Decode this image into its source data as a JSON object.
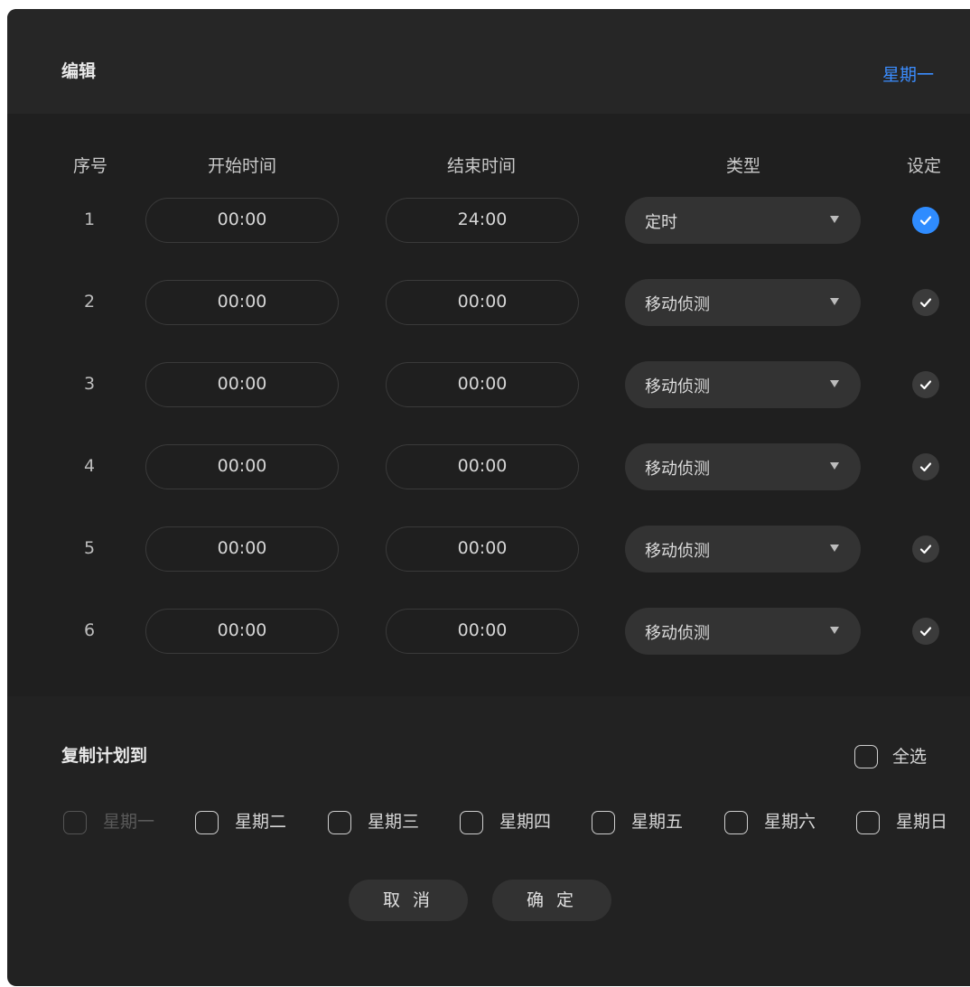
{
  "header": {
    "title": "编辑",
    "day": "星期一"
  },
  "columns": {
    "index": "序号",
    "start": "开始时间",
    "end": "结束时间",
    "type": "类型",
    "set": "设定"
  },
  "rows": [
    {
      "index": "1",
      "start": "00:00",
      "end": "24:00",
      "type": "定时",
      "checked": true
    },
    {
      "index": "2",
      "start": "00:00",
      "end": "00:00",
      "type": "移动侦测",
      "checked": false
    },
    {
      "index": "3",
      "start": "00:00",
      "end": "00:00",
      "type": "移动侦测",
      "checked": false
    },
    {
      "index": "4",
      "start": "00:00",
      "end": "00:00",
      "type": "移动侦测",
      "checked": false
    },
    {
      "index": "5",
      "start": "00:00",
      "end": "00:00",
      "type": "移动侦测",
      "checked": false
    },
    {
      "index": "6",
      "start": "00:00",
      "end": "00:00",
      "type": "移动侦测",
      "checked": false
    }
  ],
  "copy": {
    "title": "复制计划到",
    "select_all": "全选",
    "days": [
      "星期一",
      "星期二",
      "星期三",
      "星期四",
      "星期五",
      "星期六",
      "星期日"
    ]
  },
  "buttons": {
    "cancel": "取 消",
    "confirm": "确 定"
  },
  "colors": {
    "accent": "#2f8cff",
    "background": "#222222"
  }
}
